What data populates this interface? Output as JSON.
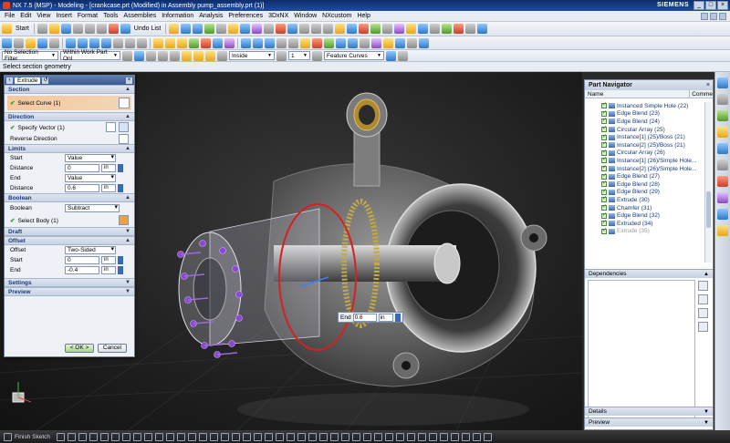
{
  "titlebar": {
    "title": "NX 7.5 (MSP) - Modeling - [crankcase.prt (Modified)  in Assembly pump_assembly.prt   (1)]",
    "brand": "SIEMENS"
  },
  "menu": [
    "File",
    "Edit",
    "View",
    "Insert",
    "Format",
    "Tools",
    "Assemblies",
    "Information",
    "Analysis",
    "Preferences",
    "3DxNX",
    "Window",
    "NXcustom",
    "Help"
  ],
  "toolbar1": {
    "start_label": "Start",
    "undo_label": "Undo List"
  },
  "toolbar3": {
    "selection_filter": "No Selection Filter",
    "scope": "Within Work Part Onl",
    "inside": "Inside",
    "count": "1",
    "curve_rule": "Feature Curves"
  },
  "status": "Select section geometry",
  "dialog": {
    "title": "Extrude",
    "section": {
      "header": "Section",
      "select_curve": "Select Curve (1)"
    },
    "direction": {
      "header": "Direction",
      "specify_vector": "Specify Vector (1)",
      "reverse": "Reverse Direction"
    },
    "limits": {
      "header": "Limits",
      "start_label": "Start",
      "start_value": "Value",
      "start_distance_label": "Distance",
      "start_distance": "0",
      "start_unit": "in",
      "end_label": "End",
      "end_value": "Value",
      "end_distance_label": "Distance",
      "end_distance": "0.6",
      "end_unit": "in"
    },
    "boolean": {
      "header": "Boolean",
      "label": "Boolean",
      "value": "Subtract",
      "select_body": "Select Body (1)"
    },
    "draft": {
      "header": "Draft"
    },
    "offset": {
      "header": "Offset",
      "offset_label": "Offset",
      "offset_value": "Two-Sided",
      "start_label": "Start",
      "start_value": "0",
      "start_unit": "in",
      "end_label": "End",
      "end_value": "-0.4",
      "end_unit": "in"
    },
    "settings": {
      "header": "Settings"
    },
    "preview": {
      "header": "Preview"
    },
    "ok": "< OK >",
    "cancel": "Cancel"
  },
  "end_float": {
    "label": "End",
    "value": "0.6",
    "unit": "in"
  },
  "bottom": {
    "finish_sketch": "Finish Sketch"
  },
  "part_navigator": {
    "title": "Part Navigator",
    "col_name": "Name",
    "col_comment": "Comme",
    "items": [
      "Instanced Simple Hole (22)",
      "Edge Blend (23)",
      "Edge Blend (24)",
      "Circular Array (25)",
      "Instance[1] (25)/Boss (21)",
      "Instance[2] (25)/Boss (21)",
      "Circular Array (26)",
      "Instance[1] (26)/Simple Hole...",
      "Instance[2] (26)/Simple Hole...",
      "Edge Blend (27)",
      "Edge Blend (28)",
      "Edge Blend (29)",
      "Extrude (30)",
      "Chamfer (31)",
      "Edge Blend (32)",
      "Extruded (34)",
      "Extrude (35)"
    ],
    "dependencies": "Dependencies",
    "details": "Details",
    "preview": "Preview"
  },
  "colors": {
    "selection_orange": "#f2c8a0",
    "preview_red": "#d62020",
    "bolt_purple": "#8a4ad0"
  }
}
